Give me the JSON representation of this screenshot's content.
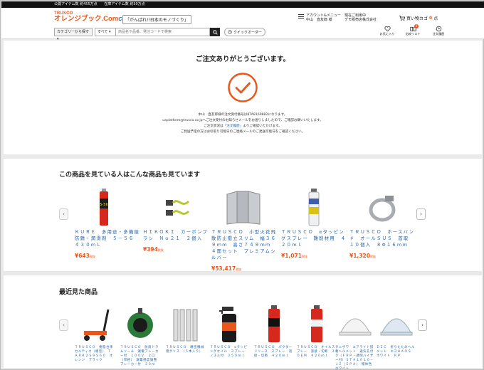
{
  "topbar": {
    "items": [
      "公開アイテム数 約455万点",
      "在庫アイテム数 約50万点"
    ]
  },
  "header": {
    "brand": "TRUSCO",
    "logo_name": "オレンジブック.Com",
    "logo_cross": "CROSS",
    "slogan": "「がんばれ!!日本のモノづくり」",
    "category_button": "カテゴリーから探す",
    "scope_select": "すべて",
    "search_placeholder": "商品名や品番、発注コードで検索",
    "quick_order": "クイックオーダー",
    "account_label": "アカウント&メニュー",
    "account_user": "中山　直友郎 様",
    "company_label": "現在ご利用中",
    "company_name": "デモ販売店株式会社",
    "cart_label": "買い物カゴ",
    "cart_count": "0",
    "cart_unit": "点",
    "icon_labels": [
      "お気に入り",
      "比較リスト",
      "注文履歴"
    ],
    "compare_badge": "0"
  },
  "confirm": {
    "title": "ご注文ありがとうございます。",
    "line1": "中山　直友郎様の注文受付番号は8TA8169882になります。",
    "line2": "uxplatform@trusco.co.jpへご注文受付のお知らせメールをお送りしましたので、ご確認お願いいたします。",
    "line3_pre": "ご注文状況は",
    "line3_link": "「注文履歴」",
    "line3_post": "よりご確認いただけます。",
    "line4": "ご発送予定の方はお引取り可能日のご連絡メールのご発送可能日をご確認ください。"
  },
  "reco": {
    "title": "この商品を見ている人はこんな商品も見ています",
    "price_suffix": "税抜",
    "products": [
      {
        "name": "ＫＵＲＥ　多用途・多機能防錆・潤滑剤　５－５６　４３０ｍＬ",
        "price": "¥643"
      },
      {
        "name": "ＨＩＫＯＫＩ　カーボンブラシ　Ｎｏ２１　２個入",
        "price": "¥394"
      },
      {
        "name": "ＴＲＵＳＣＯ　小型火花飛散防止衝立スリム　幅３６９ｍｍ　高さ７４９ｍｍ　４面セット　プレミアムシルバー",
        "price": "¥53,417"
      },
      {
        "name": "ＴＲＵＳＣＯ　αタッピングスプレー　難削材用　４２０ｍｌ",
        "price": "¥1,071"
      },
      {
        "name": "ＴＲＵＳＣＯ　ホースバンド　オールＳＵＳ　首取　１０個入　８Φ１６ｍｍ",
        "price": "¥1,320"
      }
    ]
  },
  "recent": {
    "title": "最近見た商品",
    "products": [
      {
        "name": "ＴＲＵＳＣＯ　樹脂台車　カルティオ（樹型）　ＴＡＲＫ２Ｓ９Ｓ６０　オレンジ　ブラック"
      },
      {
        "name": "ＴＲＵＳＣＯ　防雨ドラムリール　漏電ブレーカー付　１００Ｖ　２口　（単相）　漏電感度調整　ブレーカー付　３０ｍ"
      },
      {
        "name": "ＴＲＵＳＣＯ　精密機械用グリス　（５本入り）"
      },
      {
        "name": "ＴＲＵＳＣＯ　αタッピングオイル　スプレー　ノズル付　３５０ｍｌ"
      },
      {
        "name": "ＴＲＵＳＣＯ　パウダーリリース　スプレー　溶接・切断　４２０ｍｌ"
      },
      {
        "name": "ＴＲＵＳＣＯ　オイルスプレー　溶接・切断　３０ＥＭ　４２０ｍｌ"
      },
      {
        "name": "タニザワ　エアライト搭載ヘルメット　通気孔付き（ＦＲＰ・透明バイザー付）ＳＴ＃１６１０－ＪＺ（ＥＰＡ）　帽体色　ホワイト"
      },
      {
        "name": "ＤＩＣ　折りたたみヘルメット　エスＨＡＯＳ　ホワイト　ＫＰ"
      }
    ]
  },
  "colors": {
    "accent": "#e8581c",
    "link": "#1f5fa8",
    "background": "#e9e9e9"
  }
}
